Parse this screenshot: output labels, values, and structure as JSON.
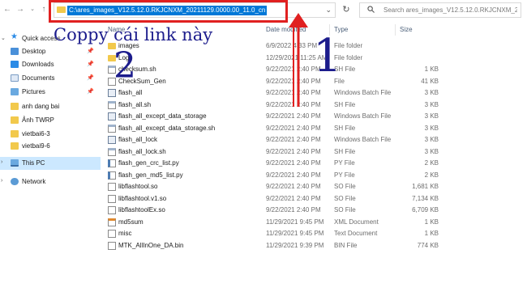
{
  "address_bar": {
    "path": "C:\\ares_images_V12.5.12.0.RKJCNXM_20211129.0000.00_11.0_cn"
  },
  "search": {
    "placeholder": "Search ares_images_V12.5.12.0.RKJCNXM_2..."
  },
  "annotation": {
    "caption": "Coppy cái link này",
    "num1": "1",
    "num2": "2",
    "color": "#e02020",
    "text_color": "#1c1c8c"
  },
  "sidebar": {
    "items": [
      {
        "label": "Quick access",
        "icon": "star-icon"
      },
      {
        "label": "Desktop",
        "icon": "desktop-icon"
      },
      {
        "label": "Downloads",
        "icon": "downloads-icon"
      },
      {
        "label": "Documents",
        "icon": "documents-icon"
      },
      {
        "label": "Pictures",
        "icon": "pictures-icon"
      },
      {
        "label": "anh dang bai",
        "icon": "folder-icon"
      },
      {
        "label": "Ảnh TWRP",
        "icon": "folder-icon"
      },
      {
        "label": "vietbai6-3",
        "icon": "folder-icon"
      },
      {
        "label": "vietbai9-6",
        "icon": "folder-icon"
      },
      {
        "label": "This PC",
        "icon": "pc-icon"
      },
      {
        "label": "Network",
        "icon": "network-icon"
      }
    ]
  },
  "columns": {
    "name": "Name",
    "date": "Date modified",
    "type": "Type",
    "size": "Size"
  },
  "files": [
    {
      "name": "images",
      "date": "6/9/2022 4:33 PM",
      "type": "File folder",
      "size": "",
      "icon": "folder"
    },
    {
      "name": "Log",
      "date": "12/29/2021 11:25 AM",
      "type": "File folder",
      "size": "",
      "icon": "folder"
    },
    {
      "name": "checksum.sh",
      "date": "9/22/2021 2:40 PM",
      "type": "SH File",
      "size": "1 KB",
      "icon": "sh"
    },
    {
      "name": "CheckSum_Gen",
      "date": "9/22/2021 2:40 PM",
      "type": "File",
      "size": "41 KB",
      "icon": "file"
    },
    {
      "name": "flash_all",
      "date": "9/22/2021 2:40 PM",
      "type": "Windows Batch File",
      "size": "3 KB",
      "icon": "bat"
    },
    {
      "name": "flash_all.sh",
      "date": "9/22/2021 2:40 PM",
      "type": "SH File",
      "size": "3 KB",
      "icon": "sh"
    },
    {
      "name": "flash_all_except_data_storage",
      "date": "9/22/2021 2:40 PM",
      "type": "Windows Batch File",
      "size": "3 KB",
      "icon": "bat"
    },
    {
      "name": "flash_all_except_data_storage.sh",
      "date": "9/22/2021 2:40 PM",
      "type": "SH File",
      "size": "3 KB",
      "icon": "sh"
    },
    {
      "name": "flash_all_lock",
      "date": "9/22/2021 2:40 PM",
      "type": "Windows Batch File",
      "size": "3 KB",
      "icon": "bat"
    },
    {
      "name": "flash_all_lock.sh",
      "date": "9/22/2021 2:40 PM",
      "type": "SH File",
      "size": "3 KB",
      "icon": "sh"
    },
    {
      "name": "flash_gen_crc_list.py",
      "date": "9/22/2021 2:40 PM",
      "type": "PY File",
      "size": "2 KB",
      "icon": "py"
    },
    {
      "name": "flash_gen_md5_list.py",
      "date": "9/22/2021 2:40 PM",
      "type": "PY File",
      "size": "2 KB",
      "icon": "py"
    },
    {
      "name": "libflashtool.so",
      "date": "9/22/2021 2:40 PM",
      "type": "SO File",
      "size": "1,681 KB",
      "icon": "so"
    },
    {
      "name": "libflashtool.v1.so",
      "date": "9/22/2021 2:40 PM",
      "type": "SO File",
      "size": "7,134 KB",
      "icon": "so"
    },
    {
      "name": "libflashtoolEx.so",
      "date": "9/22/2021 2:40 PM",
      "type": "SO File",
      "size": "6,709 KB",
      "icon": "so"
    },
    {
      "name": "md5sum",
      "date": "11/29/2021 9:45 PM",
      "type": "XML Document",
      "size": "1 KB",
      "icon": "xml"
    },
    {
      "name": "misc",
      "date": "11/29/2021 9:45 PM",
      "type": "Text Document",
      "size": "1 KB",
      "icon": "txt"
    },
    {
      "name": "MTK_AllInOne_DA.bin",
      "date": "11/29/2021 9:39 PM",
      "type": "BIN File",
      "size": "774 KB",
      "icon": "bin"
    }
  ]
}
